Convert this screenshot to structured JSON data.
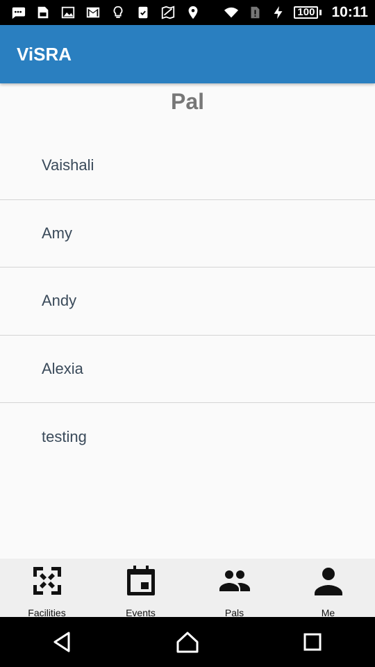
{
  "status_bar": {
    "battery_level": "100",
    "time": "10:11"
  },
  "app_bar": {
    "title": "ViSRA"
  },
  "page": {
    "title": "Pal"
  },
  "pals": [
    {
      "name": "Vaishali"
    },
    {
      "name": "Amy"
    },
    {
      "name": "Andy"
    },
    {
      "name": "Alexia"
    },
    {
      "name": "testing"
    }
  ],
  "bottom_nav": {
    "items": [
      {
        "label": "Facilities",
        "icon": "fullscreen-icon"
      },
      {
        "label": "Events",
        "icon": "calendar-icon"
      },
      {
        "label": "Pals",
        "icon": "people-icon"
      },
      {
        "label": "Me",
        "icon": "person-icon"
      }
    ]
  }
}
